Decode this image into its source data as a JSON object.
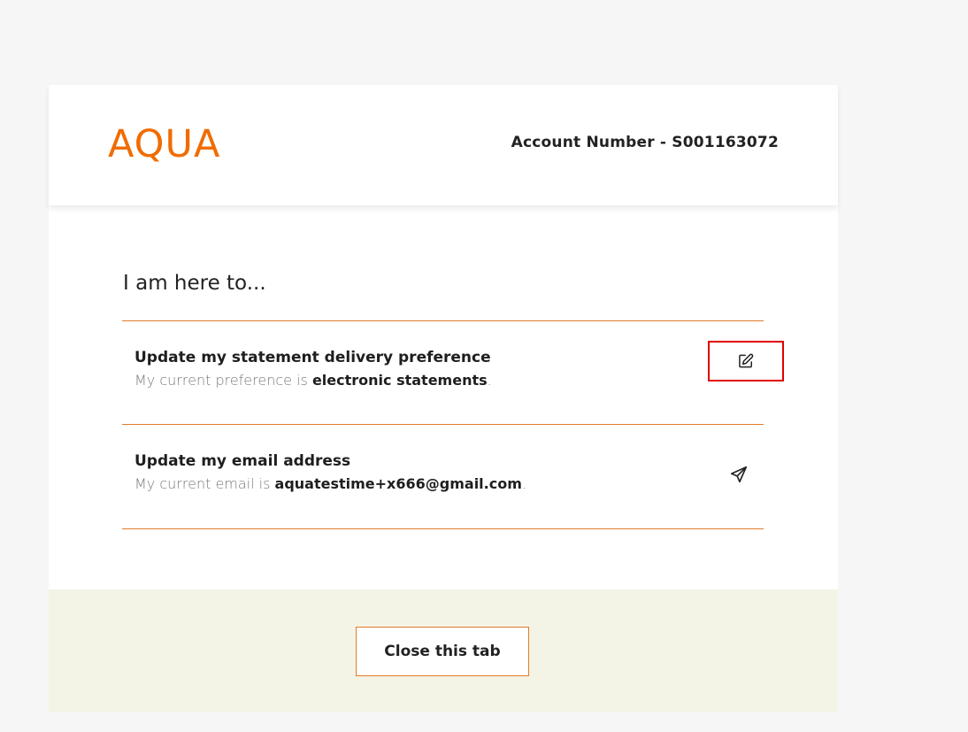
{
  "header": {
    "logo_text": "AQUA",
    "account_label": "Account Number - S001163072"
  },
  "main": {
    "intro": "I am here to...",
    "options": [
      {
        "title": "Update my statement delivery preference",
        "desc_prefix": "My current preference is ",
        "desc_value": "electronic statements",
        "desc_suffix": ".",
        "icon": "edit-icon"
      },
      {
        "title": "Update my email address",
        "desc_prefix": "My current email is ",
        "desc_value": "aquatestime+x666@gmail.com",
        "desc_suffix": ".",
        "icon": "send-icon"
      }
    ]
  },
  "footer": {
    "close_label": "Close this tab"
  },
  "colors": {
    "brand": "#f06c00",
    "divider": "#e07a2a",
    "highlight": "#e00000",
    "footer_bg": "#f4f4e6"
  }
}
